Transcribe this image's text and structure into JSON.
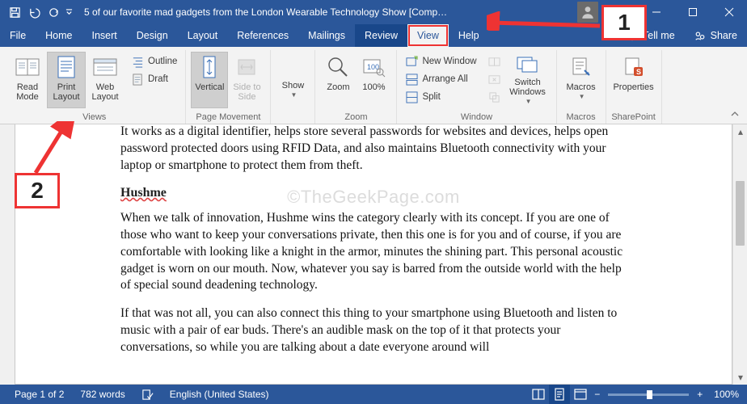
{
  "titlebar": {
    "title": "5 of our favorite mad gadgets from the London Wearable Technology Show [Comp…"
  },
  "tabs": {
    "file": "File",
    "home": "Home",
    "insert": "Insert",
    "design": "Design",
    "layout": "Layout",
    "references": "References",
    "mailings": "Mailings",
    "review": "Review",
    "view": "View",
    "help": "Help",
    "tellme": "Tell me",
    "share": "Share"
  },
  "ribbon": {
    "views": {
      "read_mode": "Read Mode",
      "print_layout": "Print Layout",
      "web_layout": "Web Layout",
      "outline": "Outline",
      "draft": "Draft",
      "group": "Views"
    },
    "page_movement": {
      "vertical": "Vertical",
      "side_to_side": "Side to Side",
      "group": "Page Movement"
    },
    "zoom": {
      "show": "Show",
      "zoom": "Zoom",
      "hundred": "100%",
      "group": "Zoom"
    },
    "window": {
      "new_window": "New Window",
      "arrange_all": "Arrange All",
      "split": "Split",
      "switch_windows": "Switch Windows",
      "group": "Window"
    },
    "macros": {
      "macros": "Macros",
      "group": "Macros"
    },
    "sharepoint": {
      "properties": "Properties",
      "group": "SharePoint"
    }
  },
  "document": {
    "p1": "It works as a digital identifier, helps store several passwords for websites and devices, helps open password protected doors using RFID Data, and also maintains Bluetooth connectivity with your laptop or smartphone to protect them from theft.",
    "h1": "Hushme",
    "p2": "When we talk of innovation, Hushme wins the category clearly with its concept. If you are one of those who want to keep your conversations private, then this one is for you and of course, if you are comfortable with looking like a knight in the armor, minutes the shining part. This personal acoustic gadget is worn on our mouth. Now, whatever you say is barred from the outside world with the help of special sound deadening technology.",
    "p3": "If that was not all, you can also connect this thing to your smartphone using Bluetooth and listen to music with a pair of ear buds. There's an audible mask on the top of it that protects your conversations, so while you are talking about a date everyone around will",
    "watermark": "©TheGeekPage.com"
  },
  "statusbar": {
    "page": "Page 1 of 2",
    "words": "782 words",
    "language": "English (United States)",
    "zoom_pct": "100%"
  },
  "callouts": {
    "one": "1",
    "two": "2"
  }
}
